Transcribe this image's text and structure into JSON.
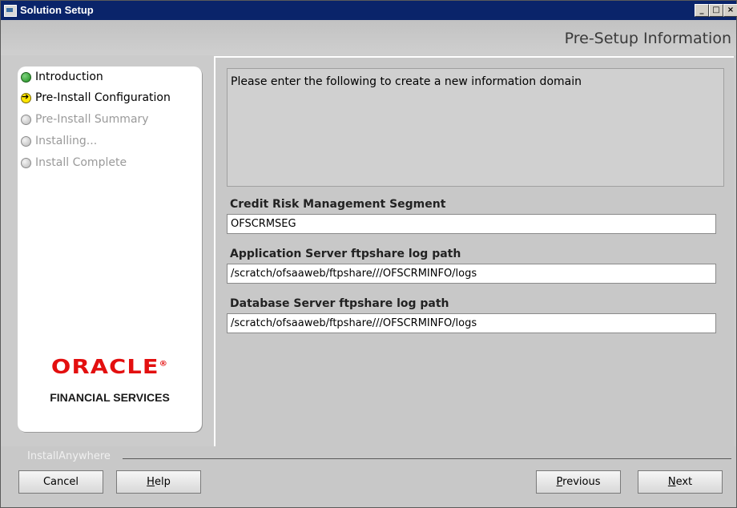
{
  "window": {
    "title": "Solution Setup"
  },
  "titlebar_buttons": {
    "minimize": "_",
    "maximize": "□",
    "close": "×"
  },
  "header": {
    "title": "Pre-Setup Information"
  },
  "steps": [
    {
      "label": "Introduction",
      "state": "done"
    },
    {
      "label": "Pre-Install Configuration",
      "state": "current"
    },
    {
      "label": "Pre-Install Summary",
      "state": "pending"
    },
    {
      "label": "Installing...",
      "state": "pending"
    },
    {
      "label": "Install Complete",
      "state": "pending"
    }
  ],
  "logo": {
    "brand": "ORACLE",
    "registered": "®",
    "tagline": "FINANCIAL SERVICES"
  },
  "info": {
    "message": "Please enter the following to create a new information domain"
  },
  "fields": [
    {
      "label": "Credit Risk Management Segment",
      "value": "OFSCRMSEG"
    },
    {
      "label": "Application Server ftpshare log path",
      "value": "/scratch/ofsaaweb/ftpshare///OFSCRMINFO/logs"
    },
    {
      "label": "Database Server ftpshare log path",
      "value": "/scratch/ofsaaweb/ftpshare///OFSCRMINFO/logs"
    }
  ],
  "footer": {
    "vendor": "InstallAnywhere",
    "cancel": "Cancel",
    "help": {
      "underlined": "H",
      "rest": "elp"
    },
    "previous": {
      "underlined": "P",
      "rest": "revious"
    },
    "next": {
      "underlined": "N",
      "rest": "ext"
    }
  },
  "icons": {
    "app": "installer-window-icon",
    "done": "check-circle-icon",
    "current": "arrow-circle-icon",
    "pending": "empty-circle-icon"
  }
}
